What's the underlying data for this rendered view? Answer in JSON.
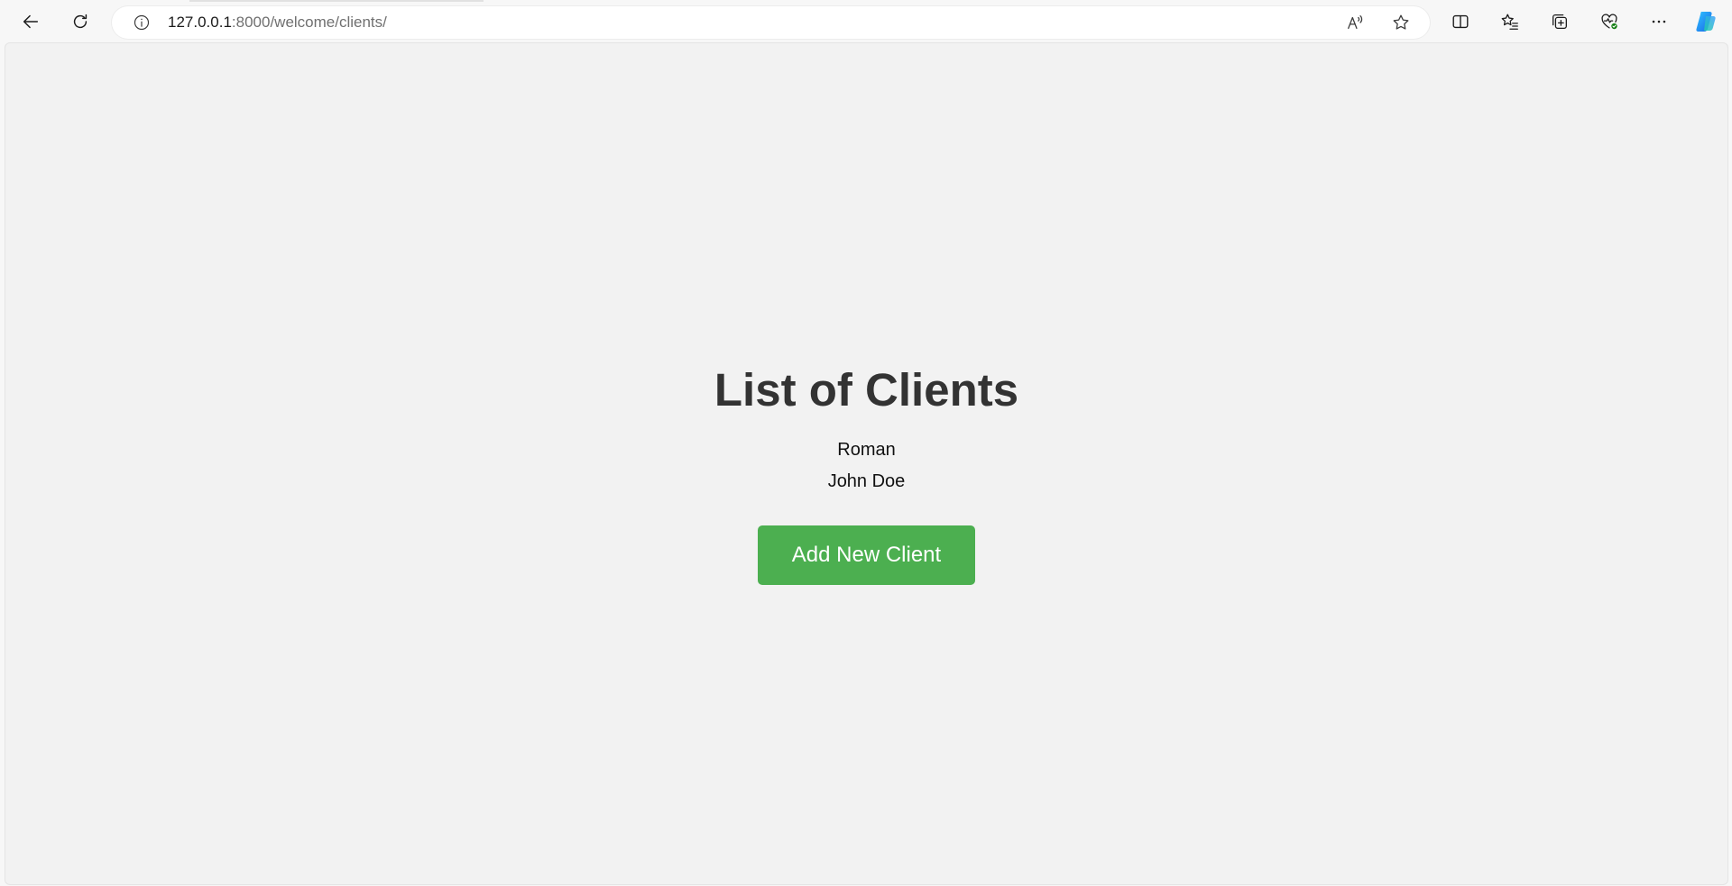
{
  "browser": {
    "url_host": "127.0.0.1",
    "url_path": ":8000/welcome/clients/",
    "icons": {
      "back": "back-arrow-icon",
      "refresh": "refresh-icon",
      "info": "info-icon",
      "read_aloud": "read-aloud-icon",
      "favorite": "star-icon",
      "split_screen": "split-screen-icon",
      "favorites": "favorites-list-icon",
      "collections": "collections-icon",
      "browser_essentials": "heart-pulse-icon",
      "more": "more-dots-icon",
      "copilot": "copilot-icon"
    }
  },
  "page": {
    "title": "List of Clients",
    "clients": [
      "Roman",
      "John Doe"
    ],
    "add_button_label": "Add New Client",
    "colors": {
      "button_bg": "#4caf50",
      "background": "#f2f2f2",
      "title": "#333333"
    }
  }
}
